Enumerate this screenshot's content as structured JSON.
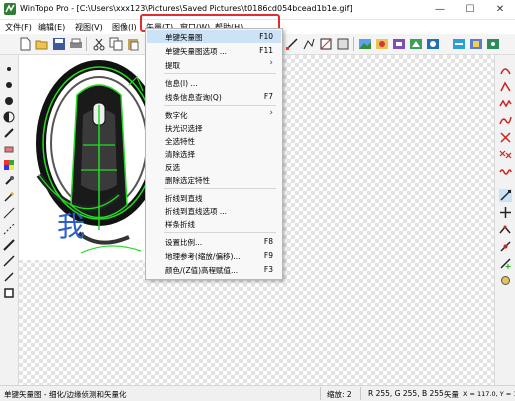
{
  "window": {
    "title": "WinTopo Pro - [C:\\Users\\xxx123\\Pictures\\Saved Pictures\\t0186cd054bcead1b1e.gif]",
    "minimize_glyph": "—",
    "maximize_glyph": "☐",
    "close_glyph": "✕"
  },
  "menubar": {
    "items": [
      {
        "label": "文件(F)"
      },
      {
        "label": "编辑(E)"
      },
      {
        "label": "视图(V)"
      },
      {
        "label": "图像(I)"
      },
      {
        "label": "矢量(T)"
      },
      {
        "label": "窗口(W)"
      },
      {
        "label": "帮助(H)"
      }
    ]
  },
  "dropdown": {
    "items": [
      {
        "label": "单键矢量图",
        "shortcut": "F10",
        "active": true
      },
      {
        "label": "单键矢量图选项 ...",
        "shortcut": "F11"
      },
      {
        "label": "提取",
        "submenu": true
      },
      {
        "label": "信息(I) ..."
      },
      {
        "label": "线条信息查询(Q)",
        "shortcut": "F7"
      },
      {
        "label": "数字化",
        "submenu": true
      },
      {
        "label": "扶光识选择"
      },
      {
        "label": "全选特性"
      },
      {
        "label": "清除选择"
      },
      {
        "label": "反选"
      },
      {
        "label": "删除选定特性"
      },
      {
        "label": "折线到直线"
      },
      {
        "label": "折线到直线选项 ..."
      },
      {
        "label": "样条折线"
      },
      {
        "label": "设置比例...",
        "shortcut": "F8"
      },
      {
        "label": "地理参考(缩放/偏移)...",
        "shortcut": "F9"
      },
      {
        "label": "颜色/(Z值)高程赋值...",
        "shortcut": "F3"
      }
    ],
    "submenu_glyph": "›"
  },
  "image": {
    "handwritten_text": "我"
  },
  "statusbar": {
    "message": "单键矢量图 - 细化/边缘侦测和矢量化",
    "zoom": "缩放: 2",
    "color": "R 255, G 255, B 255",
    "mode": "矢量",
    "coords": "X = 117.0, Y = 170.0"
  },
  "colors": {
    "highlight_border": "#e02d2d",
    "active_item": "#cce3f7",
    "vector_green": "#22dd22"
  }
}
